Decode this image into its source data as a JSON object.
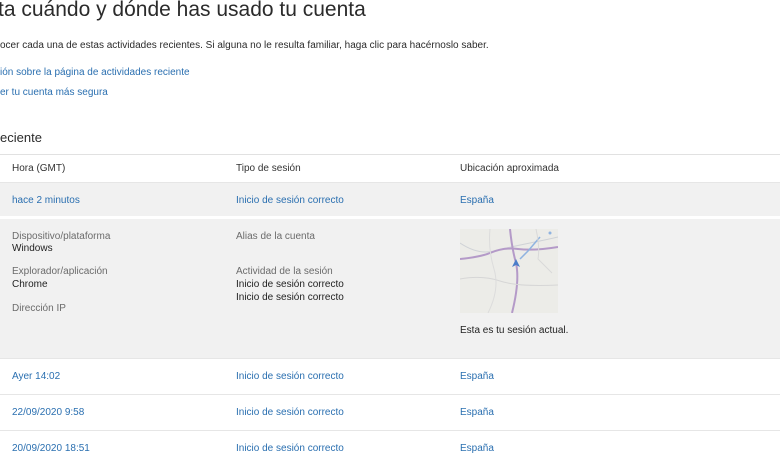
{
  "header": {
    "title": "ta cuándo y dónde has usado tu cuenta",
    "intro": "ocer cada una de estas actividades recientes. Si alguna no le resulta familiar, haga clic para hacérnoslo saber.",
    "links": [
      "ión sobre la página de actividades reciente",
      "er tu cuenta más segura"
    ]
  },
  "section": {
    "title": "eciente"
  },
  "table": {
    "columns": [
      "Hora (GMT)",
      "Tipo de sesión",
      "Ubicación aproximada"
    ],
    "rows": [
      {
        "time": "hace 2 minutos",
        "type": "Inicio de sesión correcto",
        "location": "España"
      },
      {
        "time": "Ayer 14:02",
        "type": "Inicio de sesión correcto",
        "location": "España"
      },
      {
        "time": "22/09/2020 9:58",
        "type": "Inicio de sesión correcto",
        "location": "España"
      },
      {
        "time": "20/09/2020 18:51",
        "type": "Inicio de sesión correcto",
        "location": "España"
      }
    ]
  },
  "details": {
    "device_label": "Dispositivo/plataforma",
    "device_value": "Windows",
    "browser_label": "Explorador/aplicación",
    "browser_value": "Chrome",
    "ip_label": "Dirección IP",
    "alias_label": "Alias de la cuenta",
    "activity_label": "Actividad de la sesión",
    "activity_values": [
      "Inicio de sesión correcto",
      "Inicio de sesión correcto"
    ],
    "current_session": "Esta es tu sesión actual."
  }
}
